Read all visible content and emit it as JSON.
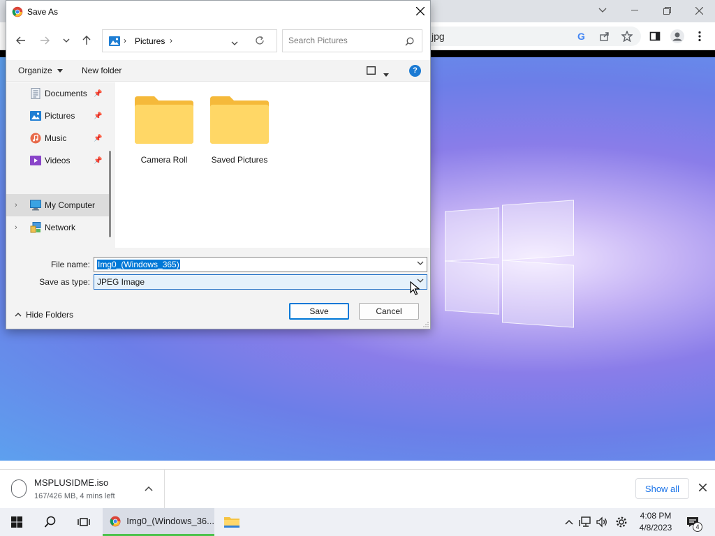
{
  "browser": {
    "address_fragment": "jpg"
  },
  "dialog": {
    "title": "Save As",
    "address": {
      "location": "Pictures"
    },
    "search": {
      "placeholder": "Search Pictures"
    },
    "commands": {
      "organize": "Organize",
      "new_folder": "New folder"
    },
    "nav_items": [
      {
        "label": "Documents",
        "pinned": true
      },
      {
        "label": "Pictures",
        "pinned": true
      },
      {
        "label": "Music",
        "pinned": true
      },
      {
        "label": "Videos",
        "pinned": true
      },
      {
        "label": "My Computer",
        "selected": true
      },
      {
        "label": "Network"
      }
    ],
    "folders": [
      {
        "name": "Camera Roll"
      },
      {
        "name": "Saved Pictures"
      }
    ],
    "file_name_label": "File name:",
    "file_name_value": "Img0_(Windows_365)",
    "save_type_label": "Save as type:",
    "save_type_value": "JPEG Image",
    "hide_folders": "Hide Folders",
    "save_button": "Save",
    "cancel_button": "Cancel"
  },
  "downloads": {
    "file_name": "MSPLUSIDME.iso",
    "status": "167/426 MB, 4 mins left",
    "show_all": "Show all"
  },
  "taskbar": {
    "chrome_window_label": "Img0_(Windows_36...",
    "time": "4:08 PM",
    "date": "4/8/2023",
    "notification_count": "4",
    "accent_color": "#4cc24c"
  }
}
